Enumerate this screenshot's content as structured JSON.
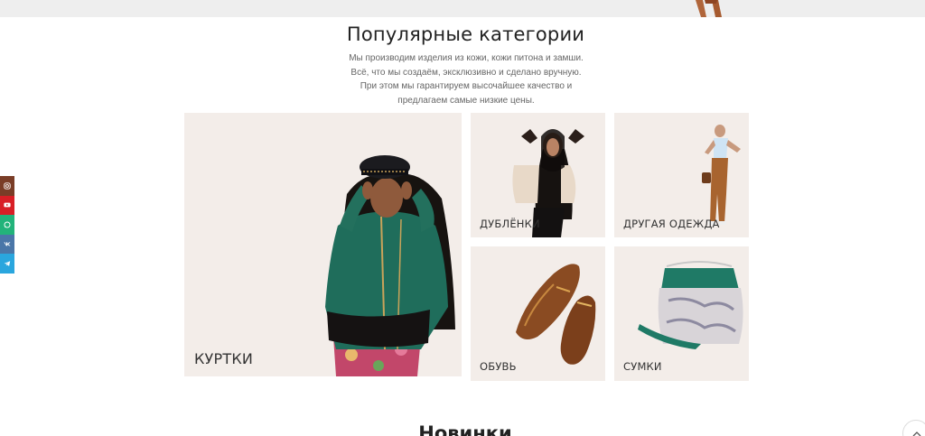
{
  "popular": {
    "title": "Популярные категории",
    "description": "Мы производим изделия из кожи, кожи питона и замши. Всё, что мы создаём, эксклюзивно и сделано вручную. При этом мы гарантируем высочайшее качество и предлагаем самые низкие цены."
  },
  "categories": [
    {
      "label": "Куртки"
    },
    {
      "label": "Дублёнки"
    },
    {
      "label": "Другая одежда"
    },
    {
      "label": "Обувь"
    },
    {
      "label": "Сумки"
    }
  ],
  "social": [
    {
      "icon": "instagram-icon",
      "color": "#7a3d27"
    },
    {
      "icon": "youtube-icon",
      "color": "#d81f26"
    },
    {
      "icon": "whatsapp-icon",
      "color": "#22b37a"
    },
    {
      "icon": "vk-icon",
      "color": "#4a76a8"
    },
    {
      "icon": "telegram-icon",
      "color": "#2aa6de"
    }
  ],
  "new_section": {
    "title": "Новинки"
  }
}
